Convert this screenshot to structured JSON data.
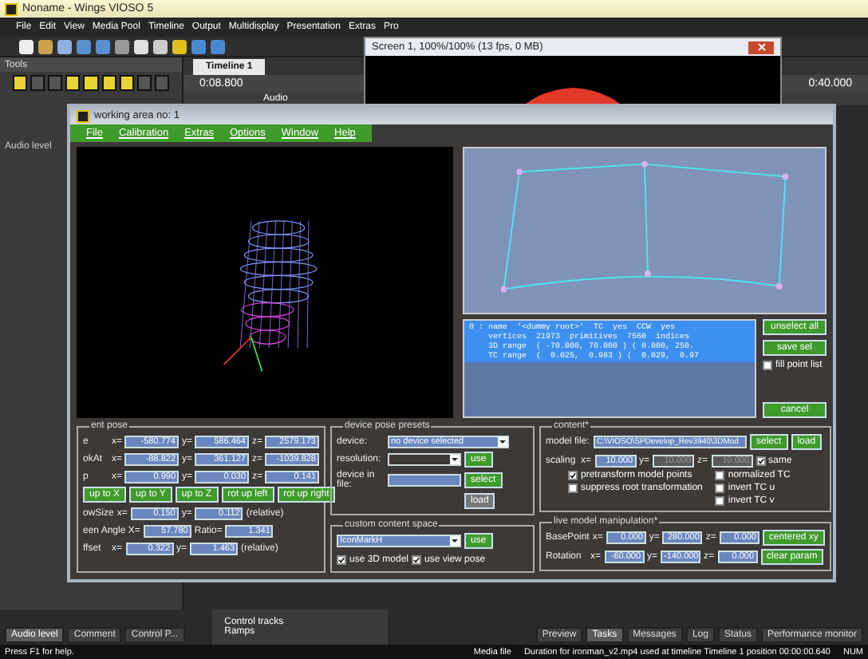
{
  "app": {
    "title": "Noname - Wings VIOSO 5",
    "menu": [
      "File",
      "Edit",
      "View",
      "Media Pool",
      "Timeline",
      "Output",
      "Multidisplay",
      "Presentation",
      "Extras",
      "Pro"
    ]
  },
  "tools_panel": {
    "title": "Tools",
    "audio_label": "Audio level"
  },
  "timeline": {
    "tab": "Timeline 1",
    "time": "0:08.800",
    "track": "Audio",
    "end_time": "0:40.000"
  },
  "screen_window": {
    "title": "Screen 1, 100%/100% (13 fps, 0 MB)"
  },
  "dialog": {
    "title": "working area no: 1",
    "menu": [
      "File",
      "Calibration",
      "Extras",
      "Options",
      "Window",
      "Help"
    ],
    "object_list": [
      "0 : name  '<dummy root>'  TC  yes  CCW  yes",
      "    vertices  21973  primitives  7560  indices",
      "    3D range  ( -70.000, 70.000 ) ( 0.000, 250.",
      "    TC range  (  0.025,  0.983 ) (  0.029,  0.97"
    ],
    "side_buttons": [
      "unselect all",
      "save sel"
    ],
    "fill_point_list": {
      "label": "fill point list",
      "checked": false
    },
    "cancel": "cancel",
    "pose": {
      "title": "ent pose",
      "rows": [
        {
          "label": "e",
          "fields": [
            {
              "label": "x=",
              "value": "-580.774"
            },
            {
              "label": "y=",
              "value": "586.464"
            },
            {
              "label": "z=",
              "value": "2579.173"
            }
          ]
        },
        {
          "label": "okAt",
          "fields": [
            {
              "label": "x=",
              "value": "-88.822"
            },
            {
              "label": "y=",
              "value": "361.127"
            },
            {
              "label": "z=",
              "value": "-1039.828"
            }
          ]
        },
        {
          "label": "p",
          "fields": [
            {
              "label": "x=",
              "value": "0.990"
            },
            {
              "label": "y=",
              "value": "0.030"
            },
            {
              "label": "z=",
              "value": "0.141"
            }
          ]
        }
      ],
      "up_buttons": [
        "up to X",
        "up to Y",
        "up to Z",
        "rot up left",
        "rot up right"
      ],
      "view_rows": [
        {
          "label": "owSize",
          "fields": [
            {
              "label": "x=",
              "value": "0.150"
            },
            {
              "label": "y=",
              "value": "0.112"
            }
          ],
          "suffix": "(relative)"
        },
        {
          "label": "een Angle X=",
          "fields": [
            {
              "value": "57.780"
            },
            {
              "label": "Ratio=",
              "value": "1.341"
            }
          ]
        },
        {
          "label": "ffset",
          "fields": [
            {
              "label": "x=",
              "value": "0.322"
            },
            {
              "label": "y=",
              "value": "1.463"
            }
          ],
          "suffix": "(relative)"
        }
      ]
    },
    "presets": {
      "title": "device pose presets",
      "device_label": "device:",
      "device_value": "no device selected",
      "resolution_label": "resolution:",
      "use": "use",
      "file_label": "device in file:",
      "select": "select",
      "load": {
        "label": "load",
        "disabled": true
      },
      "custom_title": "custom content space",
      "custom_value": "IconMarkH",
      "custom_use": "use",
      "checks": [
        {
          "label": "use 3D model",
          "checked": true
        },
        {
          "label": "use view pose",
          "checked": true
        }
      ]
    },
    "content": {
      "title": "content*",
      "file_label": "model file:",
      "file_value": "C:\\VIOSO\\SPDevelop_Rev3940\\3DMod",
      "buttons": [
        "select",
        "load"
      ],
      "scaling_label": "scaling",
      "scaling": [
        {
          "label": "x=",
          "value": "10.000",
          "disabled": false
        },
        {
          "label": "y=",
          "value": "10.000",
          "disabled": true
        },
        {
          "label": "z=",
          "value": "10.000",
          "disabled": true
        }
      ],
      "same": {
        "label": "same",
        "checked": true
      },
      "options_left": [
        {
          "label": "pretransform model points",
          "checked": true
        },
        {
          "label": "suppress root transformation",
          "checked": false
        }
      ],
      "options_right": [
        {
          "label": "normalized TC",
          "checked": false
        },
        {
          "label": "invert TC u",
          "checked": false
        },
        {
          "label": "invert TC v",
          "checked": false
        }
      ]
    },
    "live": {
      "title": "live model manipulation*",
      "rows": [
        {
          "label": "BasePoint",
          "fields": [
            {
              "label": "x=",
              "value": "0.000"
            },
            {
              "label": "y=",
              "value": "280.000"
            },
            {
              "label": "z=",
              "value": "0.000"
            }
          ],
          "button": "centered xy"
        },
        {
          "label": "Rotation",
          "fields": [
            {
              "label": "x=",
              "value": "-60.000"
            },
            {
              "label": "y=",
              "value": "-140.000"
            },
            {
              "label": "z=",
              "value": "0.000"
            }
          ],
          "button": "clear param"
        }
      ]
    }
  },
  "bottom": {
    "left_tabs": [
      {
        "label": "Audio level",
        "selected": true
      },
      {
        "label": "Comment",
        "selected": false
      },
      {
        "label": "Control P...",
        "selected": false
      }
    ],
    "tree": [
      "Control tracks",
      "Ramps"
    ],
    "right_tabs": [
      {
        "label": "Preview",
        "selected": false
      },
      {
        "label": "Tasks",
        "selected": true
      },
      {
        "label": "Messages",
        "selected": false
      },
      {
        "label": "Log",
        "selected": false
      },
      {
        "label": "Status",
        "selected": false
      },
      {
        "label": "Performance monitor",
        "selected": false
      }
    ]
  },
  "status_bar": {
    "help": "Press F1 for help.",
    "media": "Media file",
    "message": "Duration for ironman_v2.mp4 used at timeline Timeline 1 position 00:00:00.640",
    "mode": "NUM"
  }
}
